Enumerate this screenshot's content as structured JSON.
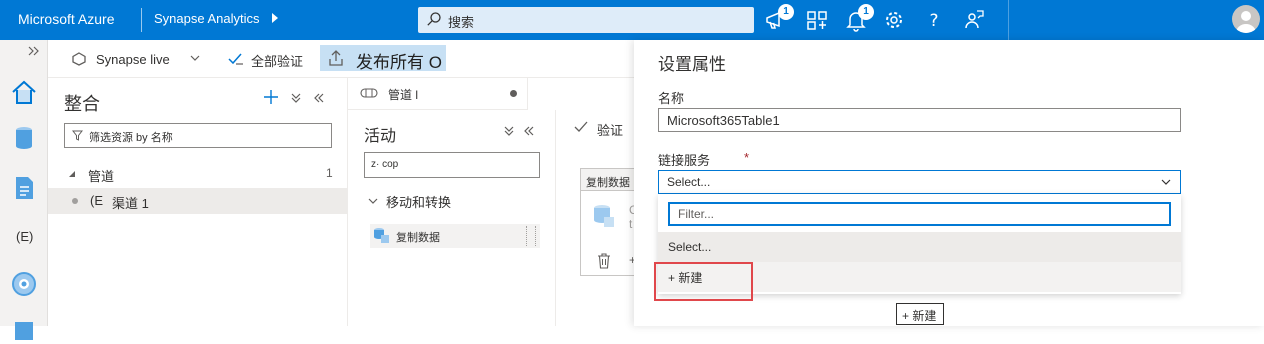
{
  "topbar": {
    "brand": "Microsoft Azure",
    "app_name": "Synapse Analytics",
    "search_placeholder": "搜索",
    "notifications_badge": "1",
    "alerts_badge": "1"
  },
  "toolbar": {
    "live_mode": "Synapse live",
    "validate_all": "全部验证",
    "publish_all": "发布所有 O"
  },
  "integrate": {
    "title": "整合",
    "filter_placeholder": "筛选资源 by 名称",
    "section": "管道",
    "section_count": "1",
    "item_label": "(E",
    "item_name": "渠道 1"
  },
  "editor": {
    "tab_label": "管道 l",
    "activities_title": "活动",
    "activity_search": "z· cop",
    "group": "移动和转换",
    "copy_activity": "复制数据",
    "validate": "验证",
    "node_title": "复制数据",
    "node_text_1": "C",
    "node_text_2": "t"
  },
  "rail": {
    "item_label": "(E)"
  },
  "panel": {
    "title": "设置属性",
    "name_label": "名称",
    "name_value": "Microsoft365Table1",
    "linked_service_label": "链接服务",
    "required_mark": "*",
    "select_value": "Select...",
    "filter_placeholder": "Filter...",
    "option_select": "Select...",
    "option_new": "+ 新建",
    "new_button": "+ 新建"
  },
  "colors": {
    "brand": "#0078d4",
    "highlight": "#e0474b"
  }
}
